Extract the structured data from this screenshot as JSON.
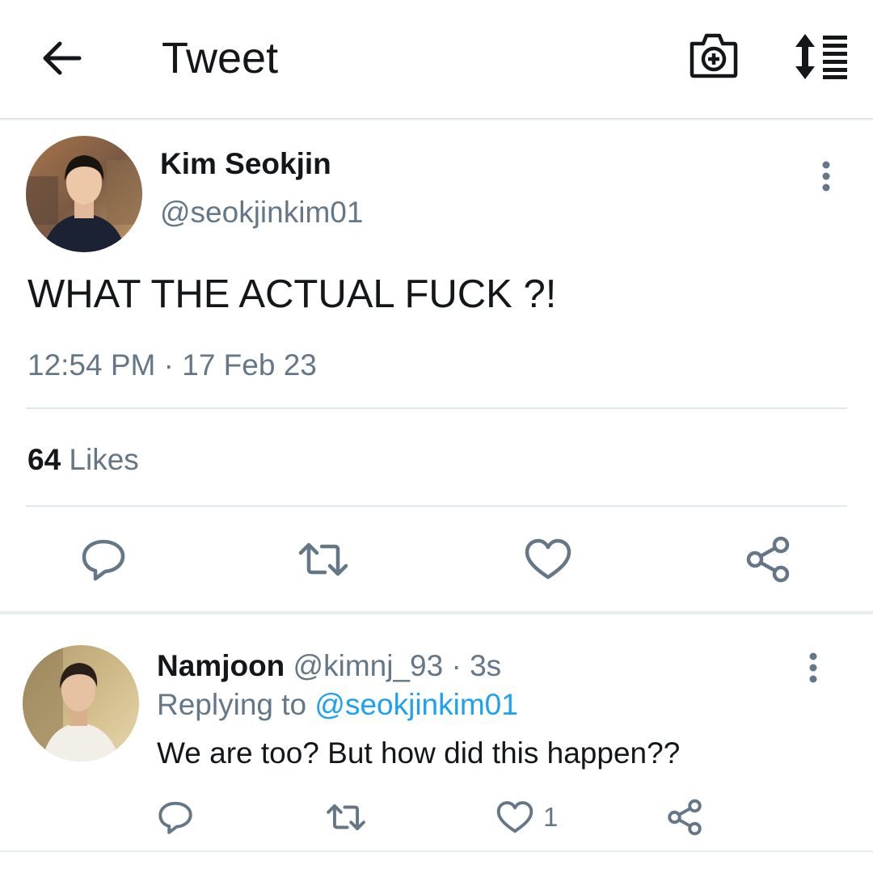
{
  "header": {
    "title": "Tweet",
    "back_icon": "arrow-left-icon",
    "camera_icon": "camera-plus-icon",
    "sort_icon": "sort-icon"
  },
  "main_tweet": {
    "author_name": "Kim Seokjin",
    "author_handle": "@seokjinkim01",
    "text": "WHAT THE ACTUAL FUCK ?!",
    "timestamp": "12:54 PM · 17 Feb 23",
    "likes_count": "64",
    "likes_label": " Likes",
    "more_icon": "more-vertical-icon"
  },
  "reply": {
    "author_name": "Namjoon",
    "author_handle": " @kimnj_93 · 3s",
    "replying_prefix": "Replying to ",
    "replying_to": "@seokjinkim01",
    "text": "We are too? But how did this happen??",
    "like_count": "1"
  },
  "colors": {
    "accent": "#1da1f2",
    "text_primary": "#14171a",
    "text_secondary": "#657786",
    "icon": "#657786",
    "divider": "#e1e8ed"
  }
}
